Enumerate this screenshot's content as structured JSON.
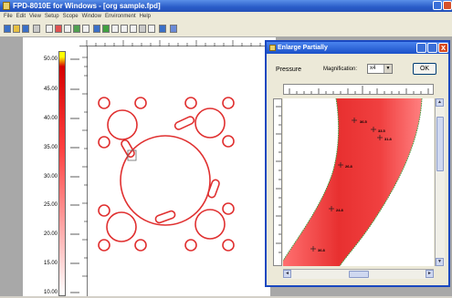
{
  "window": {
    "title": "FPD-8010E for Windows - [org sample.fpd]"
  },
  "menu": [
    "File",
    "Edit",
    "View",
    "Setup",
    "Scope",
    "Window",
    "Environment",
    "Help"
  ],
  "scale": {
    "labels": [
      "50.00",
      "45.00",
      "40.00",
      "35.00",
      "30.00",
      "25.00",
      "20.00",
      "15.00",
      "10.00"
    ]
  },
  "dialog": {
    "title": "Enlarge Partially",
    "pressure_label": "Pressure",
    "magnification_label": "Magnification:",
    "magnification_value": "x4",
    "ok_label": "OK",
    "close_glyph": "x",
    "points": [
      "36.5",
      "33.5",
      "31.8",
      "26.8",
      "24.8",
      "36.8"
    ]
  },
  "colors": {
    "pressure_red": "#e03030",
    "titlebar_blue": "#2a5cc8",
    "edge_green": "#3aa040"
  },
  "icons": [
    "app-icon",
    "minimize-icon",
    "close-icon",
    "dropdown-arrow-icon",
    "scroll-up-icon",
    "scroll-down-icon",
    "scroll-left-icon",
    "scroll-right-icon",
    "crosshair-icon"
  ]
}
